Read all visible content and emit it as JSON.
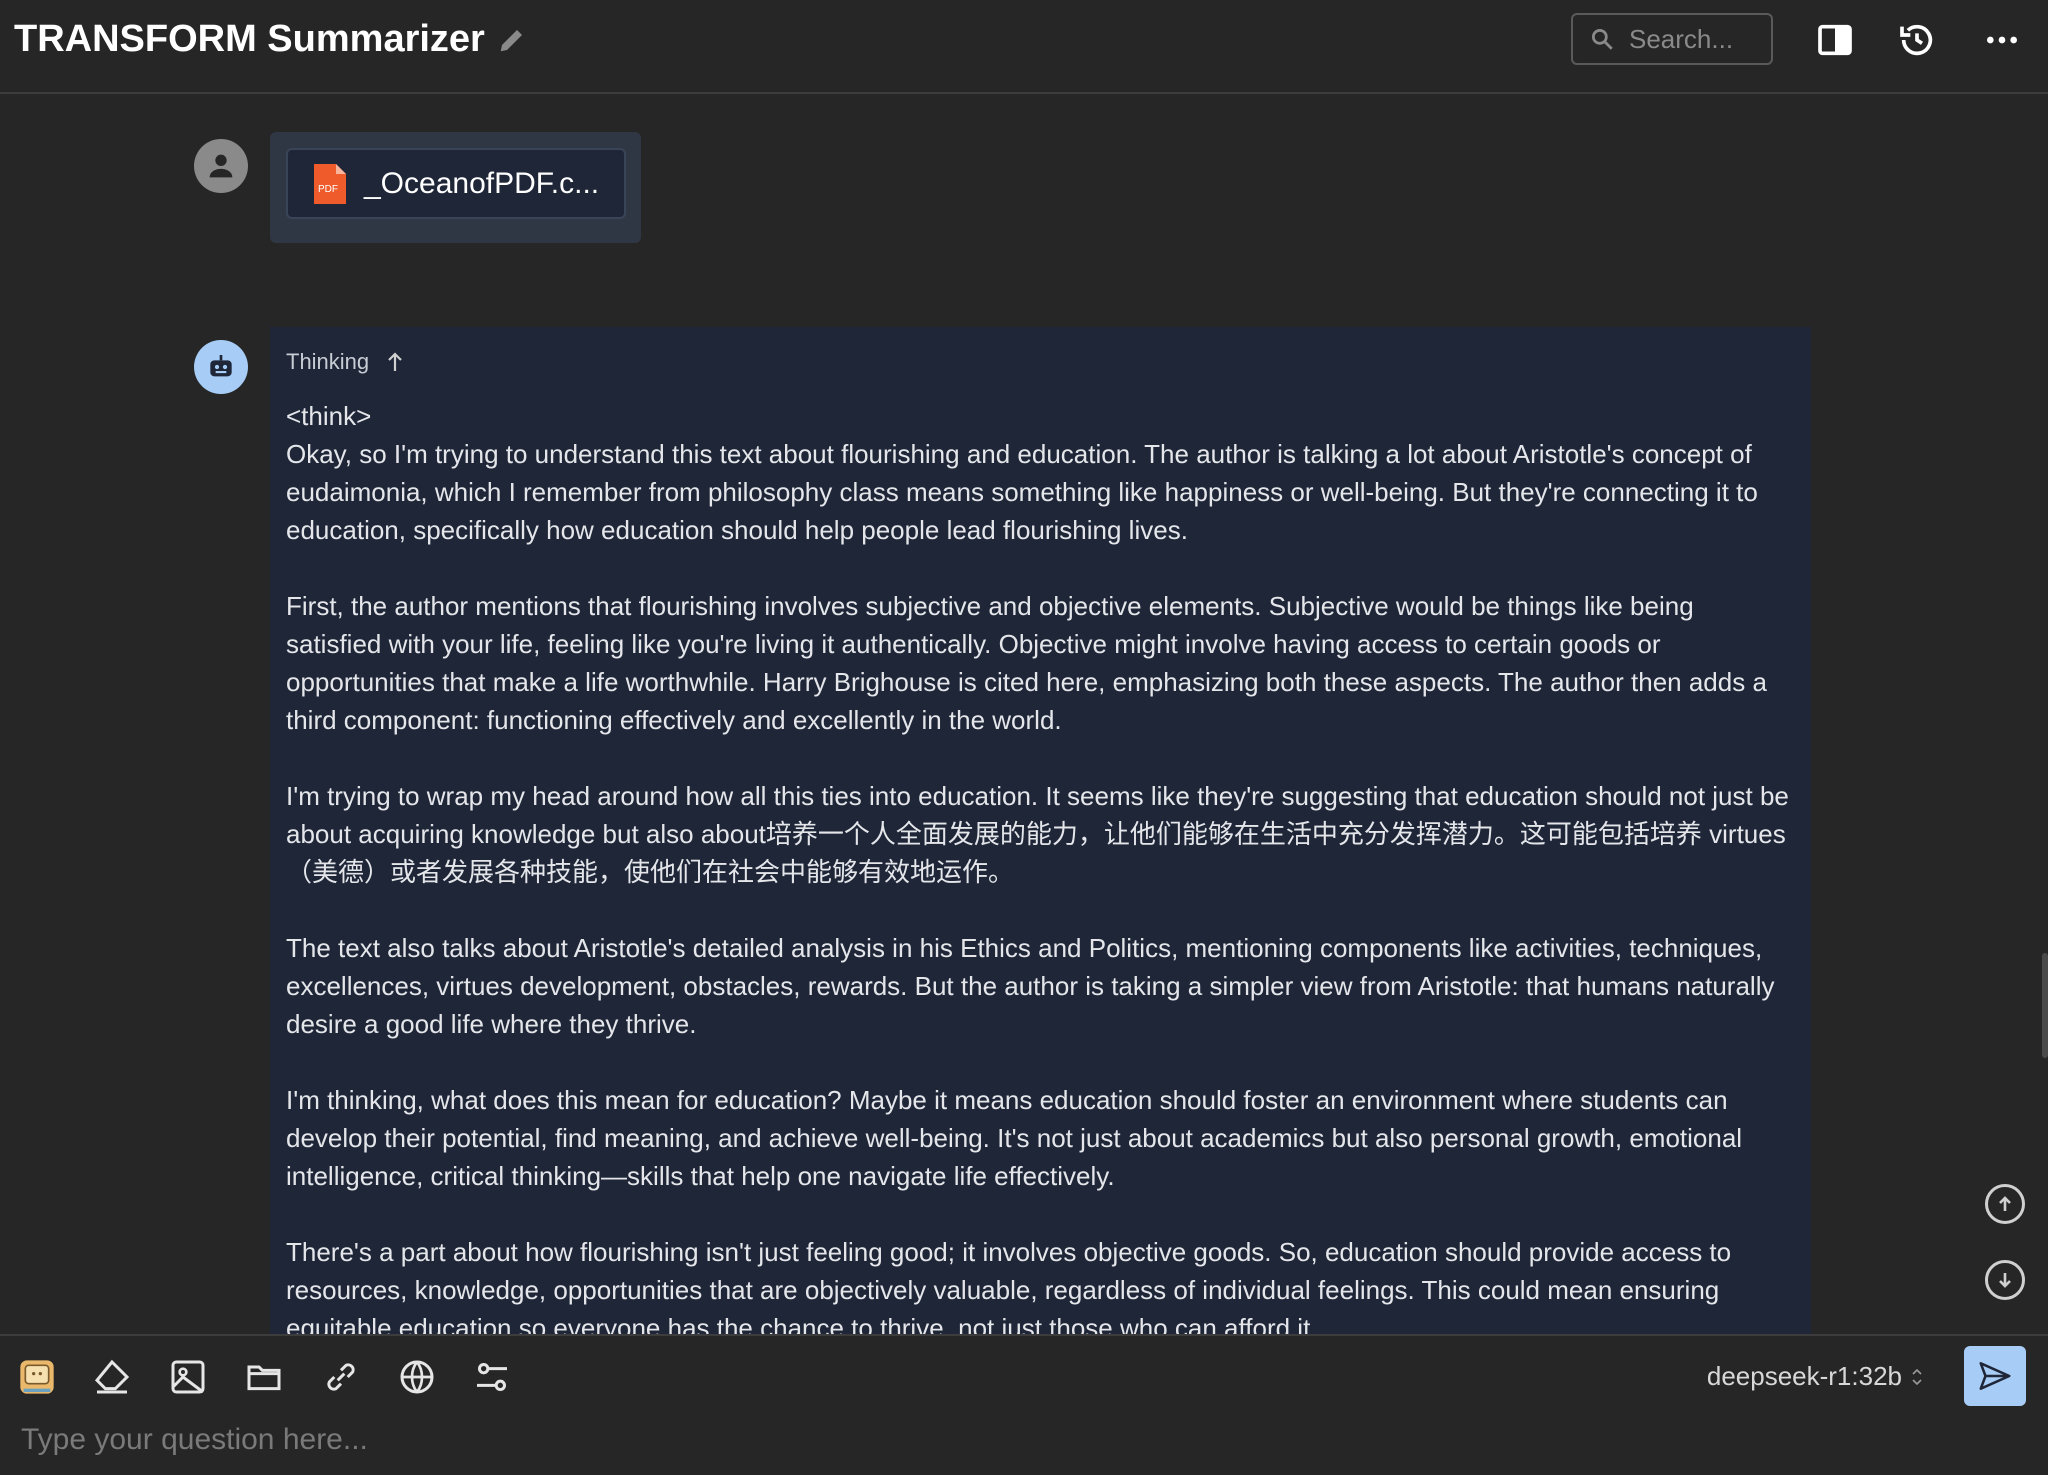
{
  "header": {
    "title": "TRANSFORM Summarizer",
    "search_placeholder": "Search..."
  },
  "attachment": {
    "file_name": "_OceanofPDF.c...",
    "file_type": "PDF"
  },
  "thinking": {
    "label": "Thinking",
    "paragraphs": [
      "<think>\nOkay, so I'm trying to understand this text about flourishing and education. The author is talking a lot about Aristotle's concept of eudaimonia, which I remember from philosophy class means something like happiness or well-being. But they're connecting it to education, specifically how education should help people lead flourishing lives.",
      "First, the author mentions that flourishing involves subjective and objective elements. Subjective would be things like being satisfied with your life, feeling like you're living it authentically. Objective might involve having access to certain goods or opportunities that make a life worthwhile. Harry Brighouse is cited here, emphasizing both these aspects. The author then adds a third component: functioning effectively and excellently in the world.",
      "I'm trying to wrap my head around how all this ties into education. It seems like they're suggesting that education should not just be about acquiring knowledge but also about培养一个人全面发展的能力，让他们能够在生活中充分发挥潜力。这可能包括培养 virtues（美德）或者发展各种技能，使他们在社会中能够有效地运作。",
      "The text also talks about Aristotle's detailed analysis in his Ethics and Politics, mentioning components like activities, techniques, excellences, virtues development, obstacles, rewards. But the author is taking a simpler view from Aristotle: that humans naturally desire a good life where they thrive.",
      "I'm thinking, what does this mean for education? Maybe it means education should foster an environment where students can develop their potential, find meaning, and achieve well-being. It's not just about academics but also personal growth, emotional intelligence, critical thinking—skills that help one navigate life effectively.",
      "There's a part about how flourishing isn't just feeling good; it involves objective goods. So, education should provide access to resources, knowledge, opportunities that are objectively valuable, regardless of individual feelings. This could mean ensuring equitable education so everyone has the chance to thrive, not just those who can afford it."
    ]
  },
  "composer": {
    "model": "deepseek-r1:32b",
    "placeholder": "Type your question here..."
  },
  "colors": {
    "accent": "#a7cdf7",
    "panel": "#1e2638",
    "background": "#262626",
    "pdf": "#ef5b2b"
  }
}
